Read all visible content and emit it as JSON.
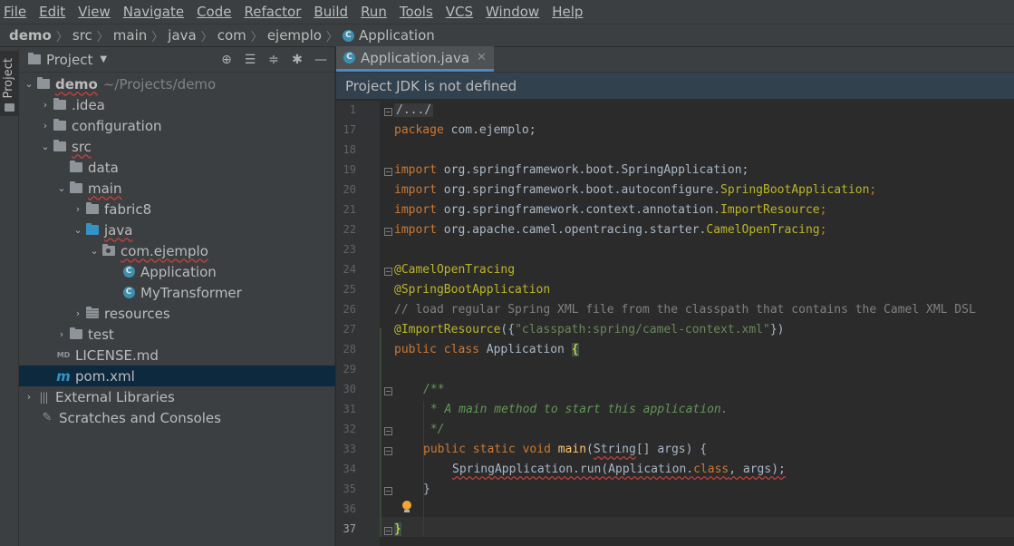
{
  "menu": [
    "File",
    "Edit",
    "View",
    "Navigate",
    "Code",
    "Refactor",
    "Build",
    "Run",
    "Tools",
    "VCS",
    "Window",
    "Help"
  ],
  "breadcrumb": [
    "demo",
    "src",
    "main",
    "java",
    "com",
    "ejemplo",
    "Application"
  ],
  "stripe": {
    "label": "Project"
  },
  "project": {
    "title": "Project",
    "tree": [
      {
        "label": "demo",
        "hint": "~/Projects/demo"
      },
      {
        "label": ".idea"
      },
      {
        "label": "configuration"
      },
      {
        "label": "src"
      },
      {
        "label": "data"
      },
      {
        "label": "main"
      },
      {
        "label": "fabric8"
      },
      {
        "label": "java"
      },
      {
        "label": "com.ejemplo"
      },
      {
        "label": "Application"
      },
      {
        "label": "MyTransformer"
      },
      {
        "label": "resources"
      },
      {
        "label": "test"
      },
      {
        "label": "LICENSE.md"
      },
      {
        "label": "pom.xml"
      },
      {
        "label": "External Libraries"
      },
      {
        "label": "Scratches and Consoles"
      }
    ]
  },
  "editor": {
    "tab_label": "Application.java",
    "banner": "Project JDK is not defined",
    "line_numbers": [
      "1",
      "17",
      "18",
      "19",
      "20",
      "21",
      "22",
      "23",
      "24",
      "25",
      "26",
      "27",
      "28",
      "29",
      "30",
      "31",
      "32",
      "33",
      "34",
      "35",
      "36",
      "37"
    ],
    "code": {
      "l1_fold": "/.../",
      "l17_kw": "package",
      "l17_rest": " com.ejemplo;",
      "import_kw": "import",
      "l19_rest": " org.springframework.boot.SpringApplication;",
      "l20_pre": " org.springframework.boot.autoconfigure.",
      "l20_an": "SpringBootApplication",
      "l20_end": ";",
      "l21_pre": " org.springframework.context.annotation.",
      "l21_an": "ImportResource",
      "l21_end": ";",
      "l22_pre": " org.apache.camel.opentracing.starter.",
      "l22_an": "CamelOpenTracing",
      "l22_end": ";",
      "l24": "@CamelOpenTracing",
      "l25": "@SpringBootApplication",
      "l26": "// load regular Spring XML file from the classpath that contains the Camel XML DSL",
      "l27_an": "@ImportResource",
      "l27_open": "({",
      "l27_str": "\"classpath:spring/camel-context.xml\"",
      "l27_close": "})",
      "l28_kw1": "public",
      "l28_kw2": "class",
      "l28_name": " Application ",
      "l28_brace": "{",
      "l30": "/**",
      "l31": " * A main method to start this application.",
      "l32": " */",
      "l33_kw1": "public",
      "l33_kw2": "static",
      "l33_kw3": "void",
      "l33_fn": "main",
      "l33_p1": "(",
      "l33_type": "String",
      "l33_rest": "[] args) {",
      "l34_pre": "SpringApplication.run(Application.",
      "l34_kw": "class",
      "l34_rest": ", args);",
      "l35": "}",
      "l37": "}"
    }
  }
}
